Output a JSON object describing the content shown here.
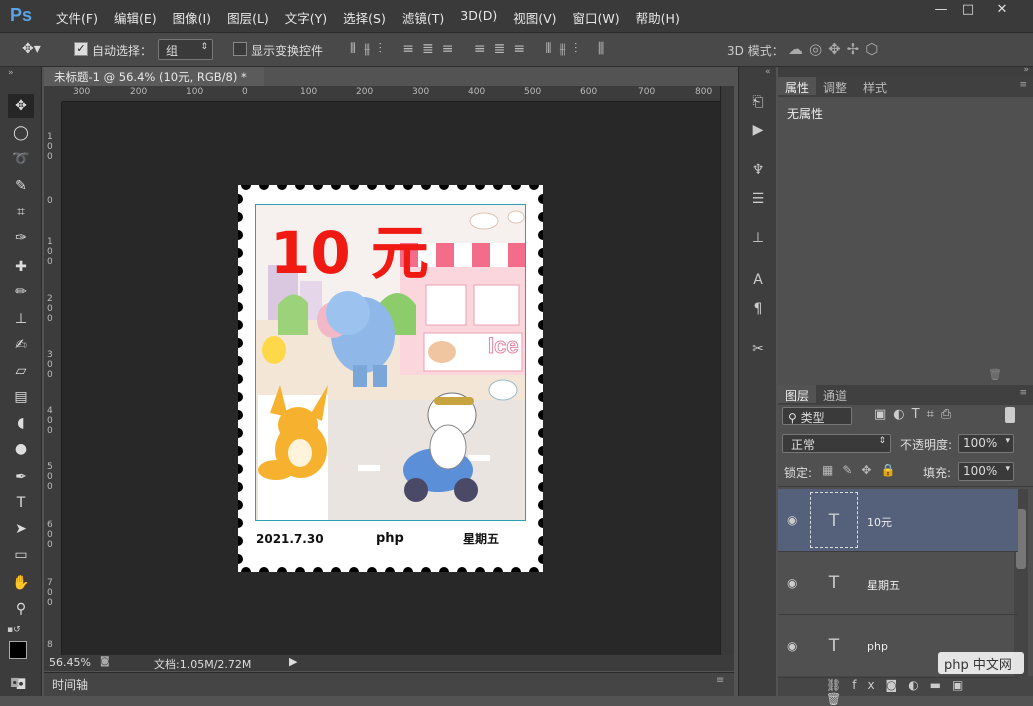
{
  "app": {
    "logo": "Ps"
  },
  "menu": [
    "文件(F)",
    "编辑(E)",
    "图像(I)",
    "图层(L)",
    "文字(Y)",
    "选择(S)",
    "滤镜(T)",
    "3D(D)",
    "视图(V)",
    "窗口(W)",
    "帮助(H)"
  ],
  "window_controls": {
    "min": "—",
    "max": "□",
    "close": "✕"
  },
  "options": {
    "auto_select_label": "自动选择：",
    "auto_select_value": "组",
    "show_transform_label": "显示变换控件",
    "mode3d_label": "3D 模式："
  },
  "document": {
    "tab_title": "未标题-1 @ 56.4% (10元, RGB/8) *",
    "tab_close": "×",
    "zoom": "56.45%",
    "doc_info": "文档:1.05M/2.72M"
  },
  "ruler_h": [
    "300",
    "200",
    "100",
    "0",
    "100",
    "200",
    "300",
    "400",
    "500",
    "600",
    "700",
    "800"
  ],
  "ruler_v": [
    "1 0 0",
    "0",
    "1 0 0",
    "2 0 0",
    "3 0 0",
    "4 0 0",
    "5 0 0",
    "6 0 0",
    "7 0 0",
    "8"
  ],
  "timeline_label": "时间轴",
  "stamp": {
    "price": "10 元",
    "date": "2021.7.30",
    "brand": "php",
    "weekday": "星期五",
    "sign": "Ice"
  },
  "panels": {
    "properties_tabs": [
      "属性",
      "调整",
      "样式"
    ],
    "properties_empty": "无属性",
    "layers_tabs": [
      "图层",
      "通道"
    ],
    "filter_kind": "类型",
    "blend_mode": "正常",
    "opacity_label": "不透明度:",
    "opacity_value": "100%",
    "lock_label": "锁定:",
    "fill_label": "填充:",
    "fill_value": "100%"
  },
  "layers": [
    {
      "name": "10元",
      "type": "T",
      "selected": true
    },
    {
      "name": "星期五",
      "type": "T",
      "selected": false
    },
    {
      "name": "php",
      "type": "T",
      "selected": false
    }
  ],
  "watermark": "php 中文网",
  "colors": {
    "accent_text": "#f01a12",
    "selection": "#55617a",
    "canvas_bg": "#282828"
  }
}
